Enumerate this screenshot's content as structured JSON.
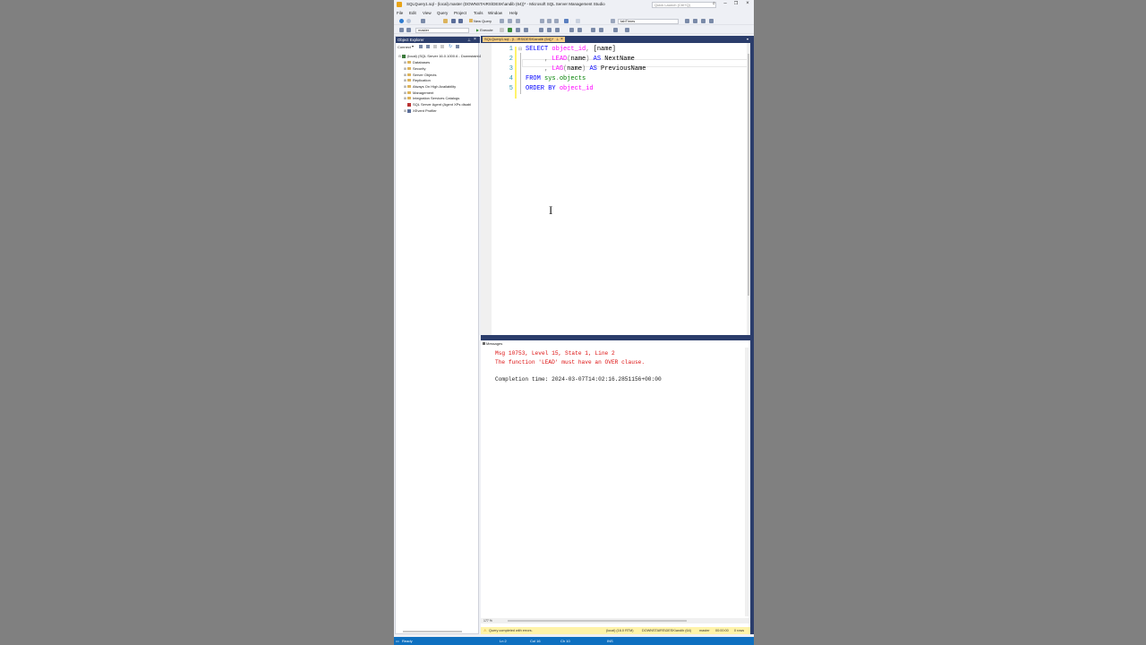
{
  "window": {
    "title": "SQLQuery1.sql - (local).master (DOWNSTAIRS\\DESK\\andib (64))* - Microsoft SQL Server Management Studio",
    "quick_launch_placeholder": "Quick Launch (Ctrl+Q)"
  },
  "menu": [
    "File",
    "Edit",
    "View",
    "Query",
    "Project",
    "Tools",
    "Window",
    "Help"
  ],
  "toolbar": {
    "new_query": "New Query",
    "find_combo": "tabTimes",
    "database_combo": "master",
    "execute": "Execute"
  },
  "object_explorer": {
    "title": "Object Explorer",
    "connect": "Connect",
    "root": "(local) (SQL Server 16.0.1000.6 - Downstairs\\D...",
    "items": [
      "Databases",
      "Security",
      "Server Objects",
      "Replication",
      "Always On High Availability",
      "Management",
      "Integration Services Catalogs",
      "SQL Server Agent (Agent XPs disabl",
      "XEvent Profiler"
    ]
  },
  "editor": {
    "tab_label": "SQLQuery1.sql - (l...IRS\\DESK\\andib (64))*",
    "line_numbers": [
      "1",
      "2",
      "3",
      "4",
      "5"
    ],
    "zoom": "177 %"
  },
  "results": {
    "tab": "Messages",
    "line1": "Msg 10753, Level 15, State 1, Line 2",
    "line2": "The function 'LEAD' must have an OVER clause.",
    "line3": "Completion time: 2024-03-07T14:02:16.2851156+00:00",
    "zoom": "177 %"
  },
  "query_status": {
    "message": "Query completed with errors.",
    "server": "(local) (16.0 RTM)",
    "user": "DOWNSTAIRS\\DESK\\andib (64)",
    "database": "master",
    "elapsed": "00:00:00",
    "rows": "0 rows"
  },
  "statusbar": {
    "ready": "Ready",
    "line": "Ln 2",
    "col": "Col 16",
    "ch": "Ch 10",
    "mode": "INS"
  }
}
